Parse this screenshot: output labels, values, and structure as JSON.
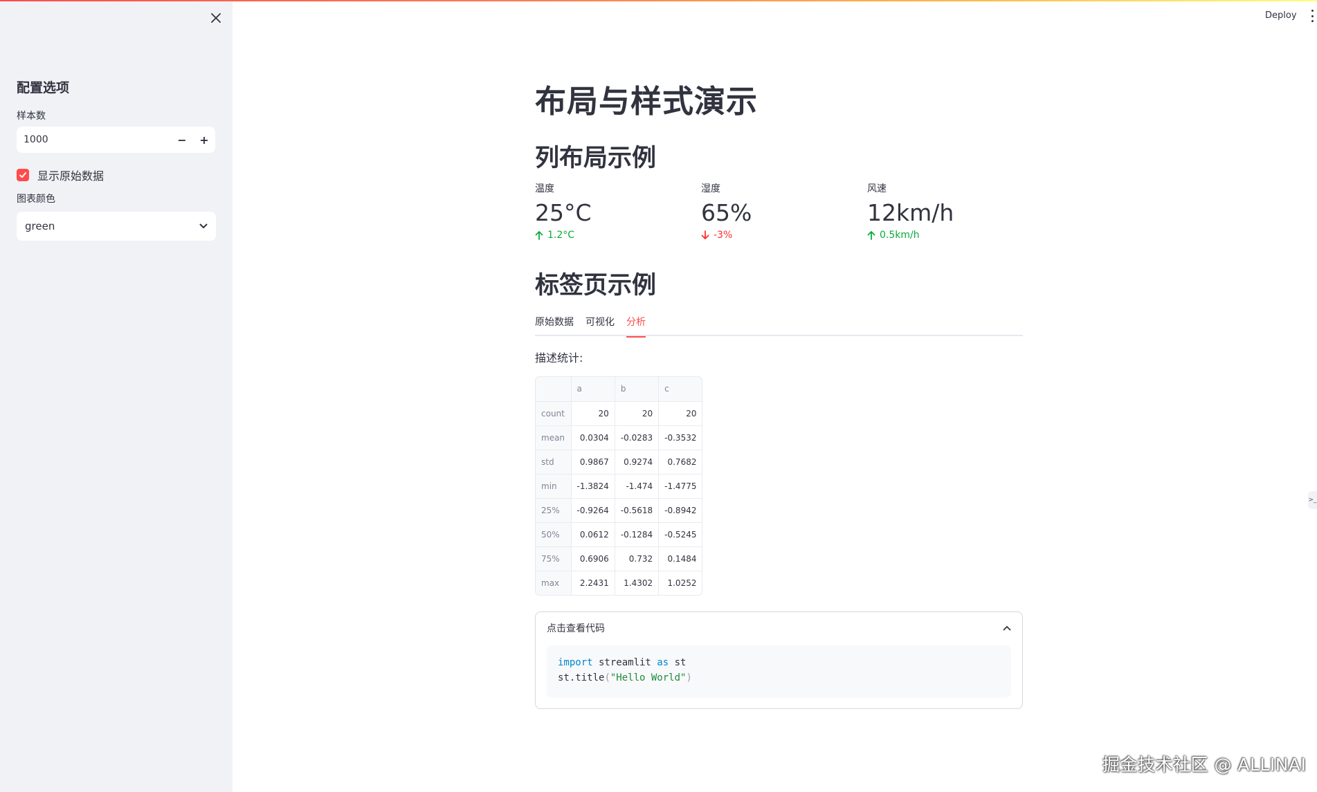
{
  "header": {
    "deploy_label": "Deploy",
    "more_icon": "vertical-ellipsis-icon"
  },
  "sidebar": {
    "close_icon": "close-icon",
    "title": "配置选项",
    "sample_label": "样本数",
    "sample_value": "1000",
    "decrement": "−",
    "increment": "+",
    "show_raw_label": "显示原始数据",
    "show_raw_checked": true,
    "color_label": "图表颜色",
    "color_value": "green"
  },
  "main": {
    "title": "布局与样式演示",
    "columns_heading": "列布局示例",
    "metrics": [
      {
        "label": "温度",
        "value": "25°C",
        "delta": "1.2°C",
        "direction": "up"
      },
      {
        "label": "湿度",
        "value": "65%",
        "delta": "-3%",
        "direction": "down"
      },
      {
        "label": "风速",
        "value": "12km/h",
        "delta": "0.5km/h",
        "direction": "up"
      }
    ],
    "tabs_heading": "标签页示例",
    "tabs": [
      "原始数据",
      "可视化",
      "分析"
    ],
    "active_tab": "分析",
    "desc_label": "描述统计:",
    "table": {
      "columns": [
        "",
        "a",
        "b",
        "c"
      ],
      "rows": [
        [
          "count",
          "20",
          "20",
          "20"
        ],
        [
          "mean",
          "0.0304",
          "-0.0283",
          "-0.3532"
        ],
        [
          "std",
          "0.9867",
          "0.9274",
          "0.7682"
        ],
        [
          "min",
          "-1.3824",
          "-1.474",
          "-1.4775"
        ],
        [
          "25%",
          "-0.9264",
          "-0.5618",
          "-0.8942"
        ],
        [
          "50%",
          "0.0612",
          "-0.1284",
          "-0.5245"
        ],
        [
          "75%",
          "0.6906",
          "0.732",
          "0.1484"
        ],
        [
          "max",
          "2.2431",
          "1.4302",
          "1.0252"
        ]
      ]
    },
    "expander": {
      "label": "点击查看代码",
      "expanded": true,
      "code_line1_kw1": "import",
      "code_line1_mid": " streamlit ",
      "code_line1_kw2": "as",
      "code_line1_end": " st",
      "code_line2_pre": "st.title",
      "code_line2_open": "(",
      "code_line2_str": "\"Hello World\"",
      "code_line2_close": ")"
    }
  },
  "colors": {
    "accent": "#ff4b4b",
    "delta_up": "#09ab3b",
    "delta_down": "#ff2b2b",
    "sidebar_bg": "#f0f2f6"
  },
  "watermark": "掘金技术社区 @ ALLINAI"
}
